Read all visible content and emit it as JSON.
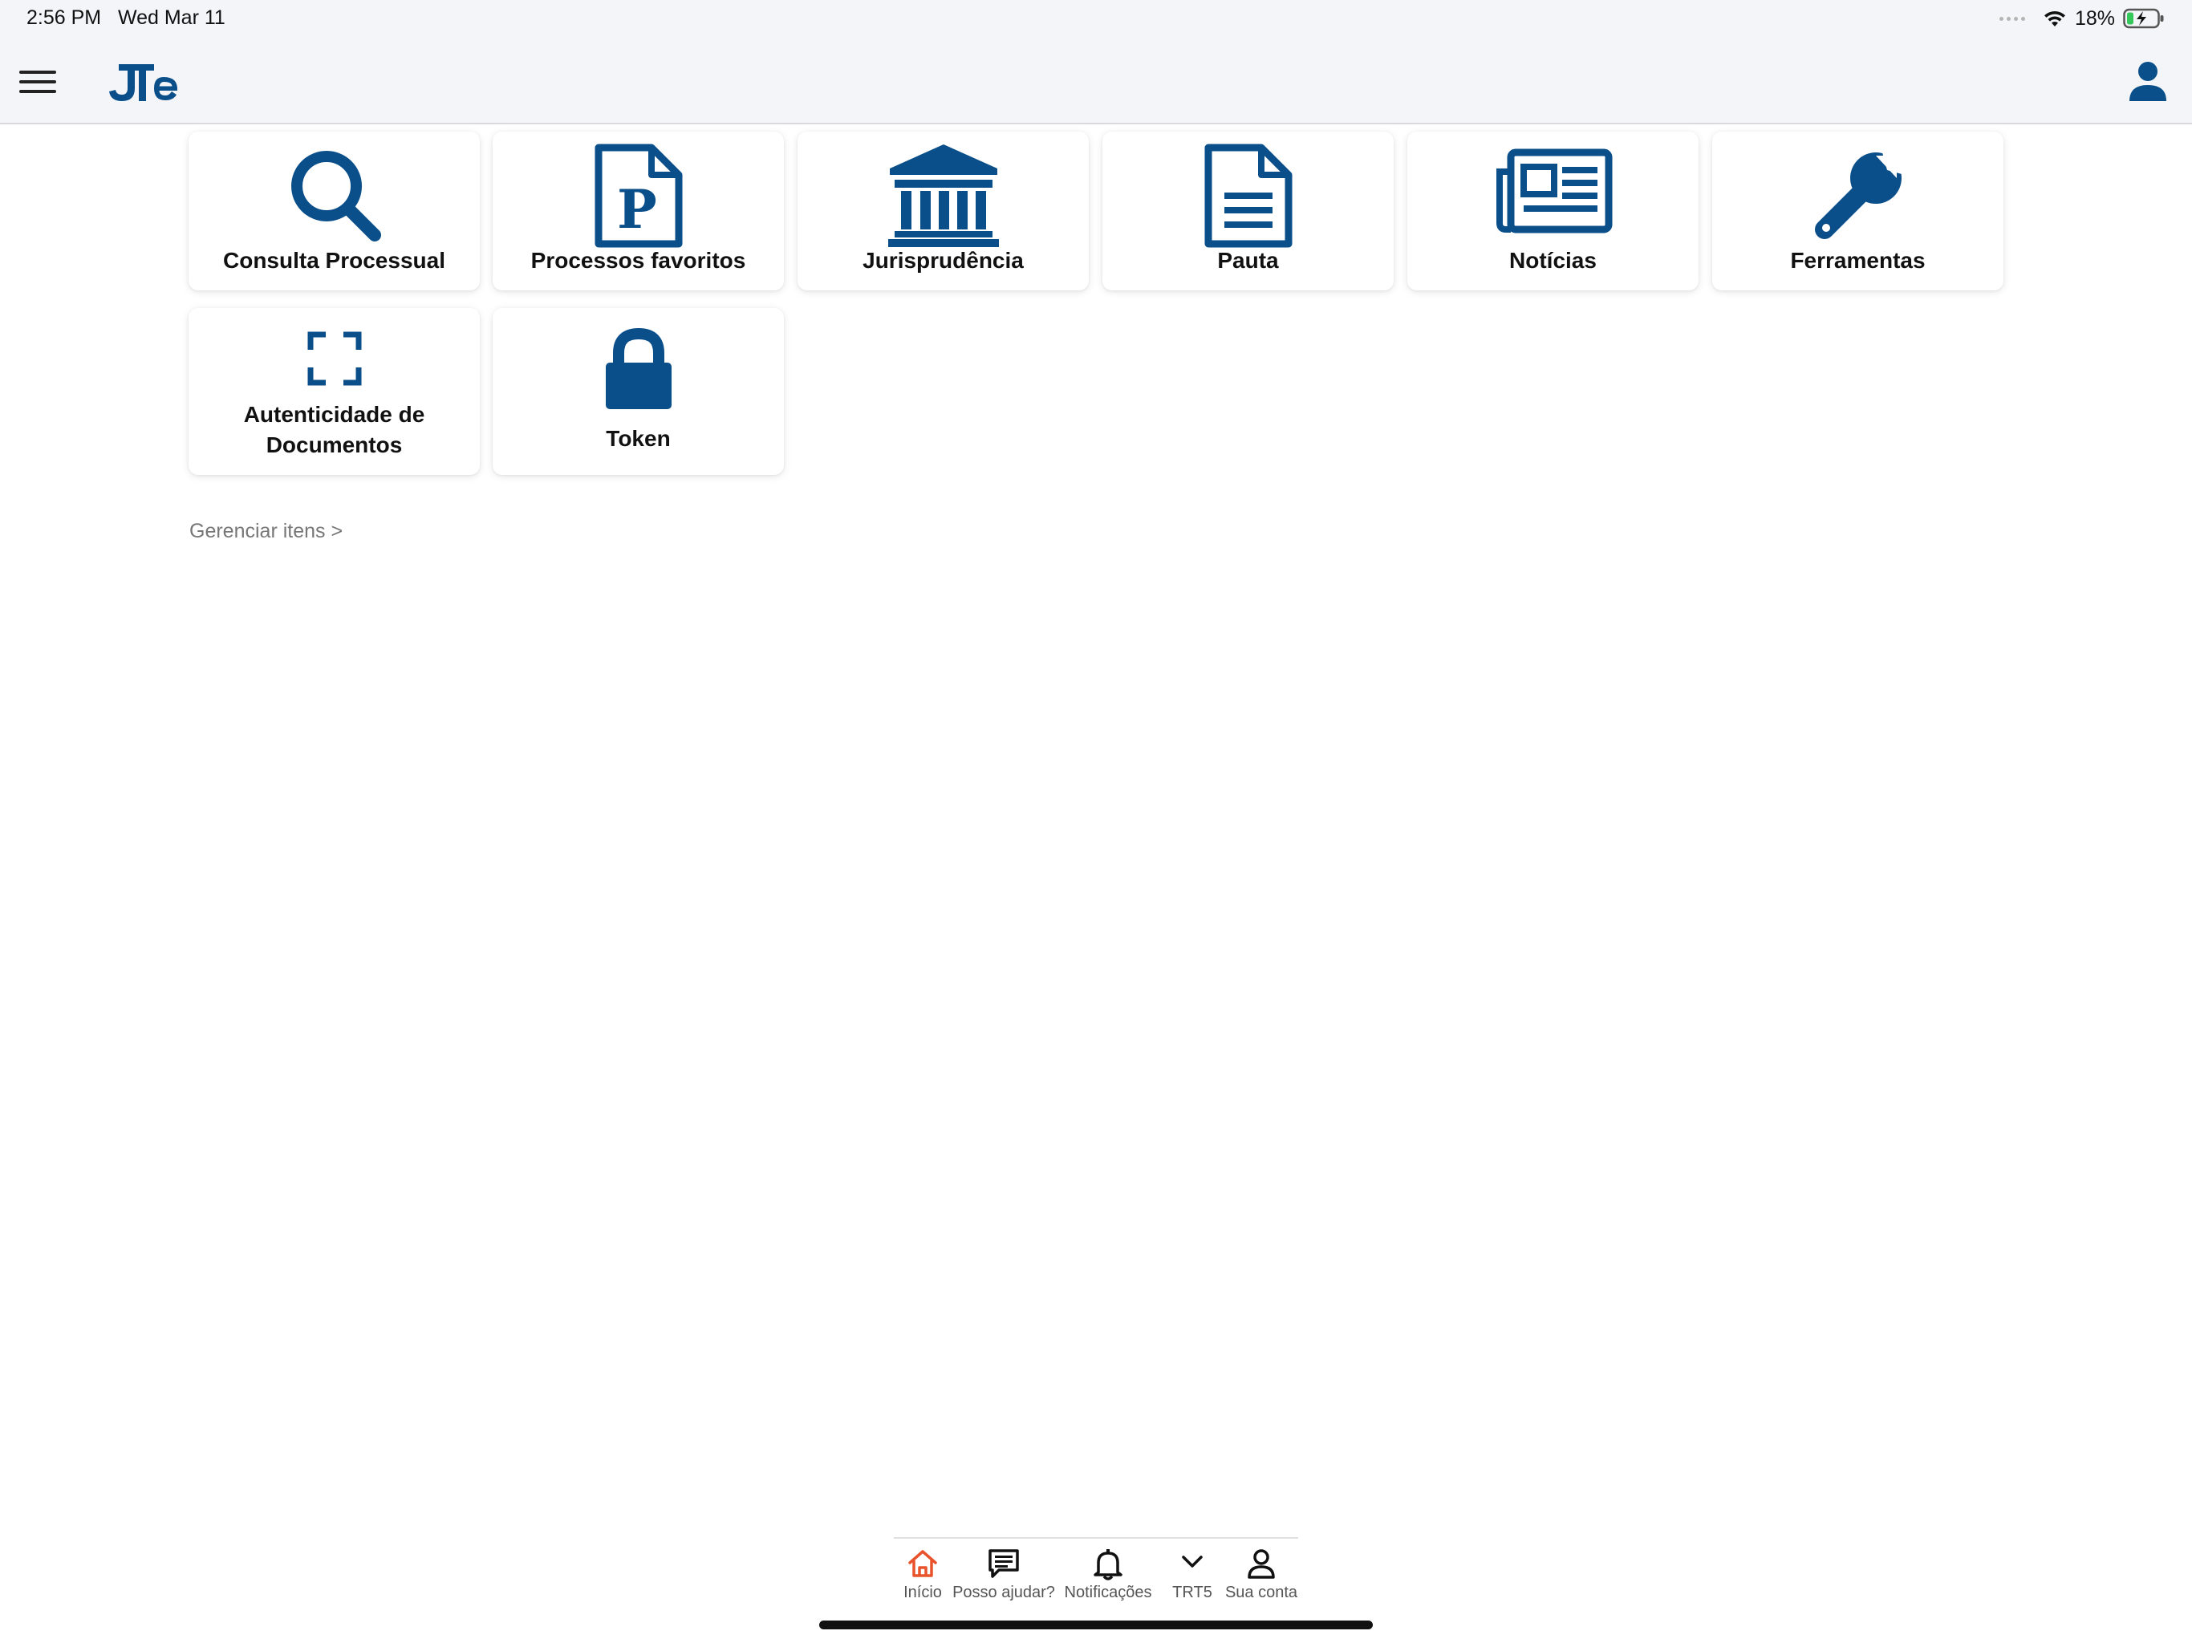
{
  "status_bar": {
    "time": "2:56 PM",
    "date": "Wed Mar 11",
    "battery_percent": "18%",
    "battery_level": 0.18
  },
  "header": {
    "menu_icon": "hamburger-menu-icon",
    "logo_icon": "jte-logo",
    "profile_icon": "user-profile-icon"
  },
  "colors": {
    "primary": "#0b4f8a",
    "accent": "#e8532b",
    "header_bg": "#f4f5f9"
  },
  "tiles": [
    {
      "label": "Consulta Processual",
      "icon": "search-icon"
    },
    {
      "label": "Processos favoritos",
      "icon": "document-p-icon"
    },
    {
      "label": "Jurisprudência",
      "icon": "courthouse-icon"
    },
    {
      "label": "Pauta",
      "icon": "document-lines-icon"
    },
    {
      "label": "Notícias",
      "icon": "newspaper-icon"
    },
    {
      "label": "Ferramentas",
      "icon": "wrench-icon"
    },
    {
      "label_line1": "Autenticidade de",
      "label_line2": "Documentos",
      "icon": "scan-frame-icon"
    },
    {
      "label": "Token",
      "icon": "lock-icon"
    }
  ],
  "manage_items_link": "Gerenciar itens >",
  "tabbar": {
    "items": [
      {
        "label": "Início",
        "icon": "home-icon",
        "active": true
      },
      {
        "label": "Posso ajudar?",
        "icon": "chat-icon"
      },
      {
        "label": "Notificações",
        "icon": "bell-icon"
      },
      {
        "label": "TRT5",
        "icon": "chevron-down-icon"
      },
      {
        "label": "Sua conta",
        "icon": "account-icon"
      }
    ]
  }
}
